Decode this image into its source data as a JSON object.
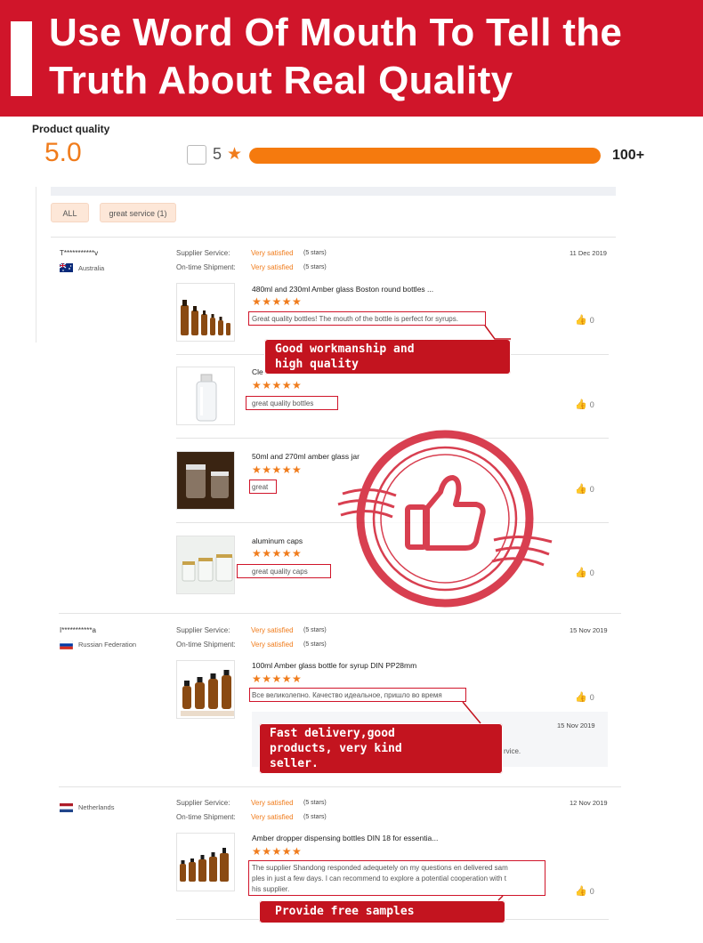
{
  "banner": {
    "title": "Use Word Of Mouth To Tell the Truth About Real Quality"
  },
  "product_quality": {
    "label": "Product quality",
    "score": "5.0",
    "star_filter": "5",
    "star_icon": "star-icon",
    "bar_fill_fraction": 1.0,
    "count": "100+"
  },
  "tags": {
    "all": "ALL",
    "great_service": "great service (1)"
  },
  "colors": {
    "banner": "#d0152a",
    "accent": "#f07c1c",
    "callout": "#c3141f"
  },
  "reviews": [
    {
      "reviewer": "T***********v",
      "country": "Australia",
      "supplier_service_label": "Supplier Service:",
      "supplier_service_value": "Very satisfied",
      "supplier_service_stars": "(5 stars)",
      "shipment_label": "On-time Shipment:",
      "shipment_value": "Very satisfied",
      "shipment_stars": "(5 stars)",
      "date": "11 Dec 2019",
      "products": [
        {
          "title": "480ml and 230ml Amber glass Boston round bottles ...",
          "stars": "★★★★★",
          "text": "Great quality bottles! The mouth of the bottle is perfect for syrups.",
          "likes": "0"
        },
        {
          "title": "Cle",
          "stars": "★★★★★",
          "text": "great quality bottles",
          "likes": "0"
        },
        {
          "title": "50ml and 270ml amber glass jar",
          "stars": "★★★★★",
          "text": "great",
          "likes": "0"
        },
        {
          "title": "aluminum caps",
          "stars": "★★★★★",
          "text": "great quality caps",
          "likes": "0"
        }
      ]
    },
    {
      "reviewer": "I***********a",
      "country": "Russian Federation",
      "supplier_service_label": "Supplier Service:",
      "supplier_service_value": "Very satisfied",
      "supplier_service_stars": "(5 stars)",
      "shipment_label": "On-time Shipment:",
      "shipment_value": "Very satisfied",
      "shipment_stars": "(5 stars)",
      "date": "15 Nov 2019",
      "products": [
        {
          "title": "100ml Amber glass bottle for syrup DIN PP28mm",
          "stars": "★★★★★",
          "text": "Все великолепно. Качество идеальное, пришло во время",
          "likes": "0"
        }
      ],
      "reply": {
        "date": "15 Nov 2019",
        "tail": "rvice."
      }
    },
    {
      "reviewer": "",
      "country": "Netherlands",
      "supplier_service_label": "Supplier Service:",
      "supplier_service_value": "Very satisfied",
      "supplier_service_stars": "(5 stars)",
      "shipment_label": "On-time Shipment:",
      "shipment_value": "Very satisfied",
      "shipment_stars": "(5 stars)",
      "date": "12 Nov 2019",
      "products": [
        {
          "title": "Amber dropper dispensing bottles DIN 18 for essentia...",
          "stars": "★★★★★",
          "text_lines": [
            "The supplier Shandong responded adequetely on my questions en delivered sam",
            "ples in just a few days. I can recommend to explore a potential cooperation with t",
            "his supplier."
          ],
          "likes": "0"
        }
      ]
    }
  ],
  "callouts": {
    "c1": "Good workmanship and\nhigh quality",
    "c2": "Fast delivery,good\nproducts, very kind\nseller.",
    "c3": "Provide free samples"
  },
  "icons": {
    "like": "thumbs-up-icon",
    "stamp": "thumbs-up-stamp-icon"
  }
}
